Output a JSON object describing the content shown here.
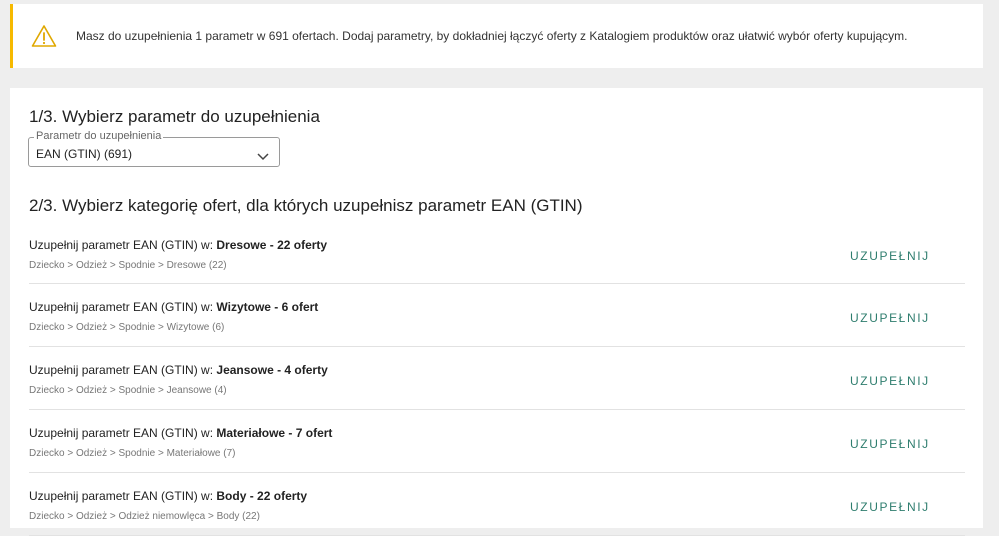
{
  "alert": {
    "icon": "warning-icon",
    "text": "Masz do uzupełnienia 1 parametr w 691 ofertach. Dodaj parametry, by dokładniej łączyć oferty z Katalogiem produktów oraz ułatwić wybór oferty kupującym.",
    "accent_color": "#f6b900"
  },
  "step1": {
    "heading": "1/3. Wybierz parametr do uzupełnienia",
    "select_label": "Parametr do uzupełnienia",
    "select_value": "EAN (GTIN) (691)",
    "select_icon": "chevron-down-icon"
  },
  "step2": {
    "heading": "2/3. Wybierz kategorię ofert, dla których uzupełnisz parametr EAN (GTIN)",
    "button_color": "#2e7d6e",
    "rows": [
      {
        "prefix": "Uzupełnij parametr EAN (GTIN) w: ",
        "name": "Dresowe - 22 oferty",
        "path": "Dziecko > Odzież > Spodnie > Dresowe (22)",
        "button": "UZUPEŁNIJ"
      },
      {
        "prefix": "Uzupełnij parametr EAN (GTIN) w: ",
        "name": "Wizytowe - 6 ofert",
        "path": "Dziecko > Odzież > Spodnie > Wizytowe (6)",
        "button": "UZUPEŁNIJ"
      },
      {
        "prefix": "Uzupełnij parametr EAN (GTIN) w: ",
        "name": "Jeansowe - 4 oferty",
        "path": "Dziecko > Odzież > Spodnie > Jeansowe (4)",
        "button": "UZUPEŁNIJ"
      },
      {
        "prefix": "Uzupełnij parametr EAN (GTIN) w: ",
        "name": "Materiałowe - 7 ofert",
        "path": "Dziecko > Odzież > Spodnie > Materiałowe (7)",
        "button": "UZUPEŁNIJ"
      },
      {
        "prefix": "Uzupełnij parametr EAN (GTIN) w: ",
        "name": "Body - 22 oferty",
        "path": "Dziecko > Odzież > Odzież niemowlęca > Body (22)",
        "button": "UZUPEŁNIJ"
      }
    ]
  }
}
